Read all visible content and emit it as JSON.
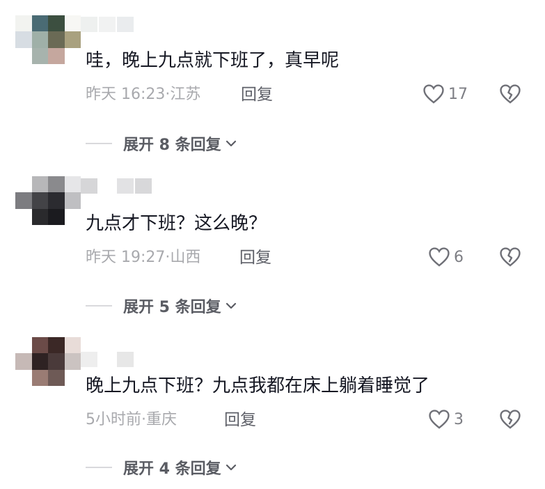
{
  "comments": [
    {
      "text": "哇，晚上九点就下班了，真早呢",
      "time": "昨天 16:23",
      "dot": "·",
      "location": "江苏",
      "reply_label": "回复",
      "likes": "17",
      "expand_label": "展开 8 条回复",
      "avatar_colors": [
        "#f2f3f0",
        "#4a6b74",
        "#3c4f40",
        "#f7f7f4",
        "#d7dde3",
        "#9fb0a8",
        "#6a6a55",
        "#a9a17f",
        "#ffffff",
        "#a7b3ad",
        "#c5a79e",
        "#ffffff"
      ],
      "name_colors": [
        "#eef0ef",
        "#f1f2f2",
        "#eaecee"
      ]
    },
    {
      "text": "九点才下班？这么晚？",
      "time": "昨天 19:27",
      "dot": "·",
      "location": "山西",
      "reply_label": "回复",
      "likes": "6",
      "expand_label": "展开 5 条回复",
      "avatar_colors": [
        "#ffffff",
        "#b7b7b9",
        "#8a8a8d",
        "#e6e6e8",
        "#7c7c80",
        "#434347",
        "#2b2b30",
        "#bfbfc2",
        "#ffffff",
        "#2a2a2d",
        "#1b1b1f",
        "#ffffff"
      ],
      "name_colors": [
        "#d6d6d8",
        "#ffffff",
        "#e2e2e4",
        "#d8d8da"
      ]
    },
    {
      "text": "晚上九点下班？九点我都在床上躺着睡觉了",
      "time": "5小时前",
      "dot": "·",
      "location": "重庆",
      "reply_label": "回复",
      "likes": "3",
      "expand_label": "展开 4 条回复",
      "avatar_colors": [
        "#ffffff",
        "#6b4b48",
        "#3b2826",
        "#e8dcd8",
        "#c6b9b6",
        "#2e2223",
        "#4a3a3a",
        "#cbc3c1",
        "#ffffff",
        "#9a7c74",
        "#6e5a56",
        "#ffffff"
      ],
      "name_colors": [
        "#eeeeee",
        "#ffffff",
        "#e7e7e7"
      ]
    }
  ]
}
